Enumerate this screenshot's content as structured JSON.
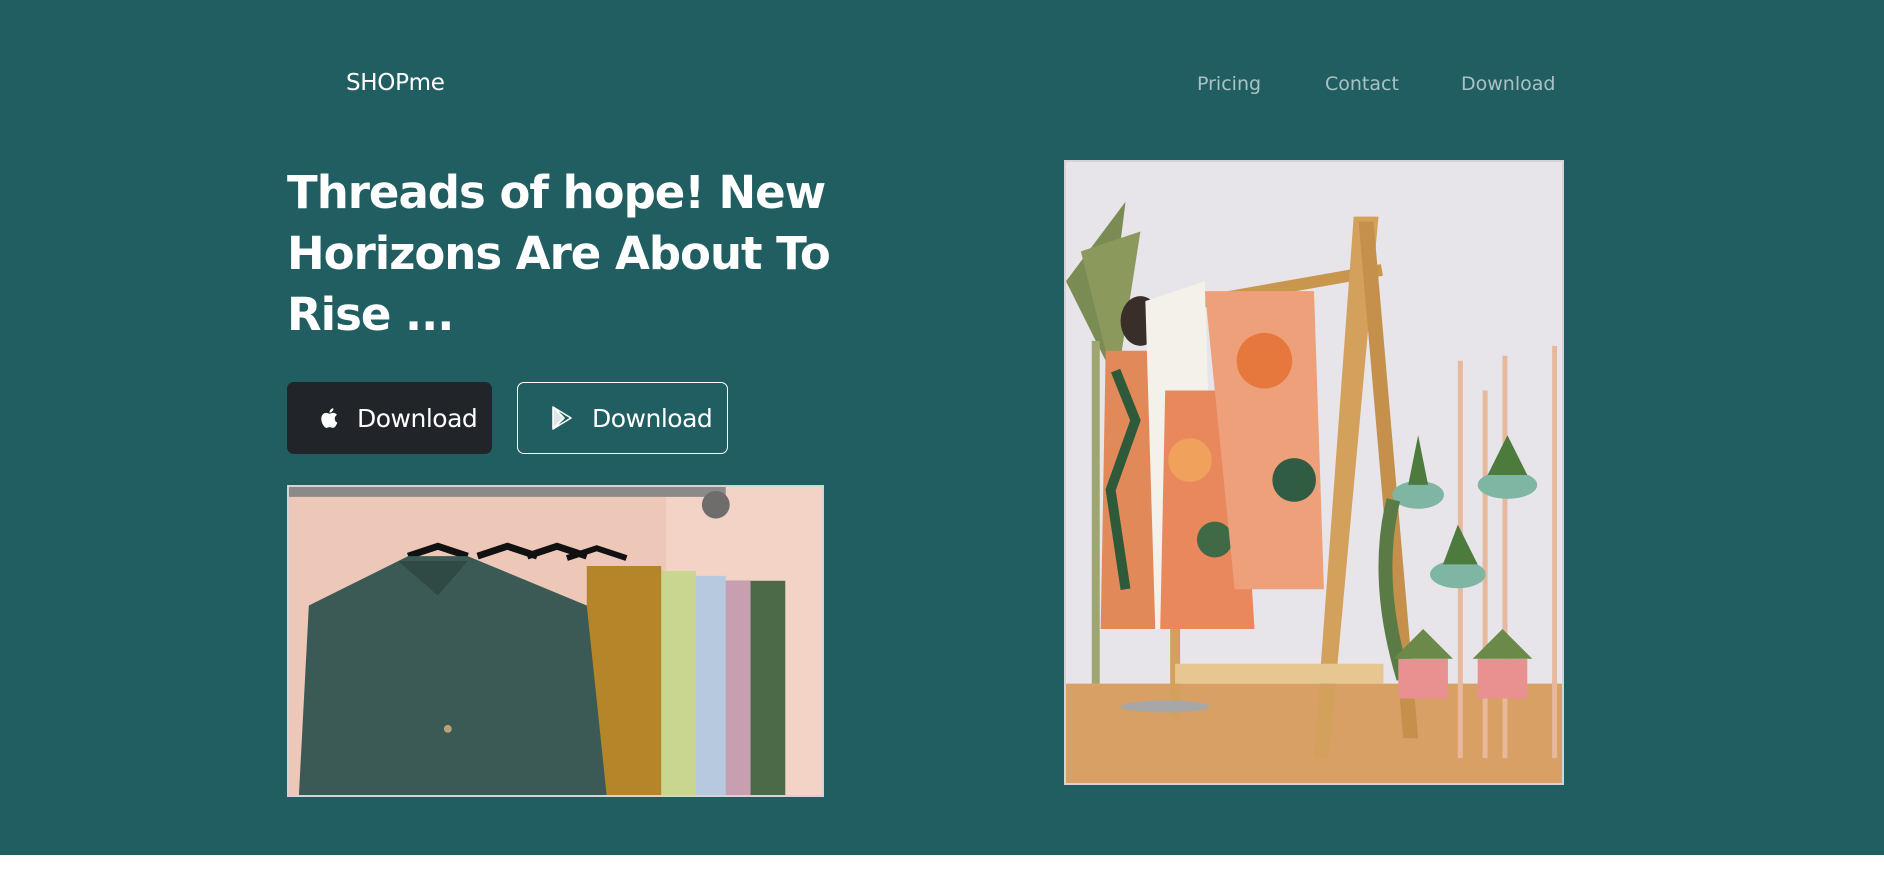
{
  "brand": {
    "name": "SHOPme"
  },
  "nav": {
    "items": [
      "Pricing",
      "Contact",
      "Download"
    ]
  },
  "hero": {
    "headline": "Threads of hope! New Horizons Are About To Rise ...",
    "buttons": {
      "apple": {
        "label": "Download",
        "icon": "apple-icon"
      },
      "play": {
        "label": "Download",
        "icon": "play-store-icon"
      }
    }
  },
  "images": {
    "rack": {
      "alt": "Shirts on hangers"
    },
    "store": {
      "alt": "Clothing rack in store"
    }
  },
  "colors": {
    "hero_bg": "#215e61",
    "button_dark": "#212529",
    "text": "#ffffff"
  }
}
